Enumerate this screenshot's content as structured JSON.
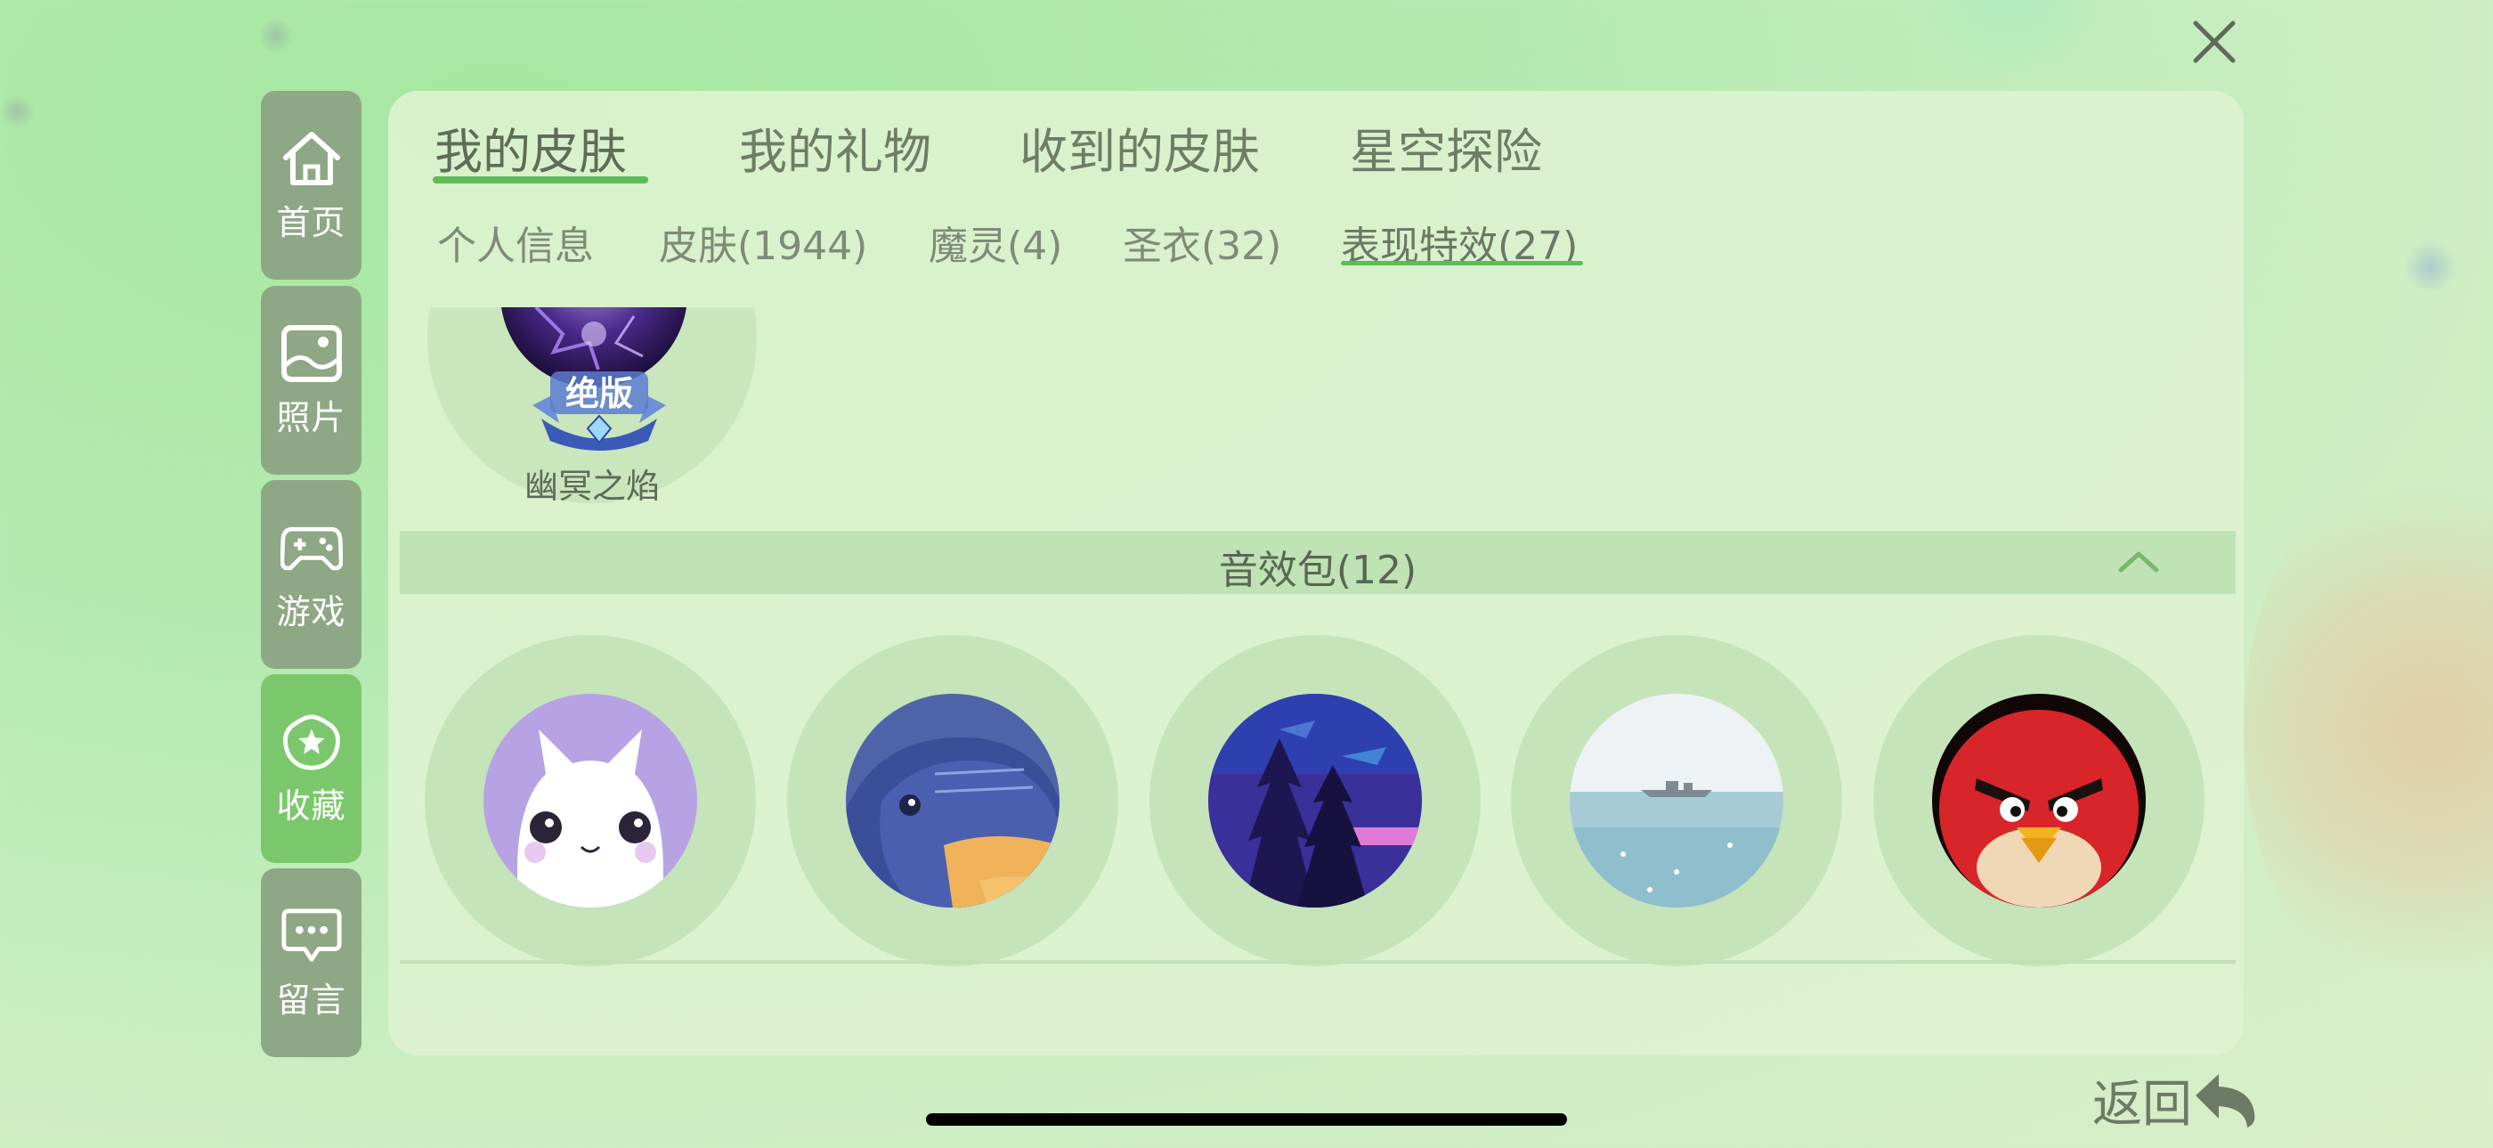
{
  "top_tabs": [
    {
      "label": "我的皮肤"
    },
    {
      "label": "我的礼物"
    },
    {
      "label": "收到的皮肤"
    },
    {
      "label": "星空探险"
    }
  ],
  "sub_tabs": [
    {
      "label": "个人信息"
    },
    {
      "label": "皮肤(1944)"
    },
    {
      "label": "魔灵(4)"
    },
    {
      "label": "圣衣(32)"
    },
    {
      "label": "表现特效(27)"
    }
  ],
  "sidebar": {
    "items": [
      {
        "label": "首页",
        "icon": "home-icon"
      },
      {
        "label": "照片",
        "icon": "photo-icon"
      },
      {
        "label": "游戏",
        "icon": "gamepad-icon"
      },
      {
        "label": "收藏",
        "icon": "star-icon"
      },
      {
        "label": "留言",
        "icon": "message-icon"
      }
    ]
  },
  "top_skin": {
    "name": "幽冥之焰",
    "badge": "绝版"
  },
  "sound_pack": {
    "title": "音效包(12)",
    "items": [
      {
        "image": "white-cat"
      },
      {
        "image": "fish"
      },
      {
        "image": "pine-forest-night"
      },
      {
        "image": "ship-at-sea"
      },
      {
        "image": "angry-red-bird"
      }
    ]
  },
  "back_label": "返回",
  "colors": {
    "accent_green": "#5fbb57",
    "sidebar_bg": "#8ea885",
    "sidebar_active": "#7bc86c"
  }
}
